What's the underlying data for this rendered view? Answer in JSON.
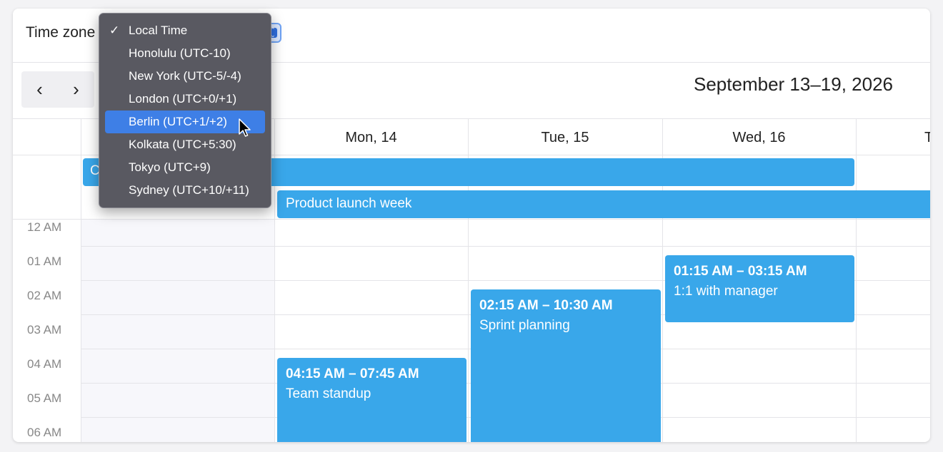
{
  "toolbar": {
    "timezone_label": "Time zone",
    "prev_icon": "chevron-left-icon",
    "next_icon": "chevron-right-icon",
    "range_title": "September 13–19, 2026"
  },
  "timezone_menu": {
    "options": [
      {
        "label": "Local Time",
        "checked": true
      },
      {
        "label": "Honolulu (UTC-10)"
      },
      {
        "label": "New York (UTC-5/-4)"
      },
      {
        "label": "London (UTC+0/+1)"
      },
      {
        "label": "Berlin (UTC+1/+2)",
        "highlighted": true
      },
      {
        "label": "Kolkata (UTC+5:30)"
      },
      {
        "label": "Tokyo (UTC+9)"
      },
      {
        "label": "Sydney (UTC+10/+11)"
      }
    ],
    "check_mark": "✓"
  },
  "days": [
    "Mon, 14",
    "Tue, 15",
    "Wed, 16",
    "T"
  ],
  "allday": {
    "bar1_label": "C",
    "bar2_label": "Product launch week"
  },
  "hours": [
    "12 AM",
    "01 AM",
    "02 AM",
    "03 AM",
    "04 AM",
    "05 AM",
    "06 AM"
  ],
  "events": [
    {
      "time": "04:15 AM – 07:45 AM",
      "title": "Team standup"
    },
    {
      "time": "02:15 AM – 10:30 AM",
      "title": "Sprint planning"
    },
    {
      "time": "01:15 AM – 03:15 AM",
      "title": "1:1 with manager"
    }
  ],
  "colors": {
    "event": "#39a7ea",
    "menu_bg": "#595961",
    "menu_selected": "#3e7fe6"
  }
}
